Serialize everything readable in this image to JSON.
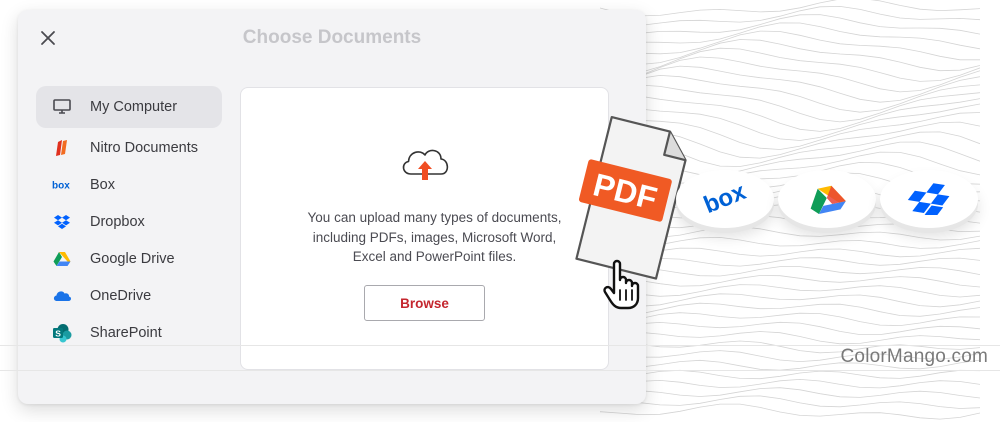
{
  "dialog": {
    "title": "Choose Documents"
  },
  "sidebar": {
    "items": [
      {
        "label": "My Computer",
        "icon": "monitor-icon",
        "active": true
      },
      {
        "label": "Nitro Documents",
        "icon": "nitro-icon"
      },
      {
        "label": "Box",
        "icon": "box-logo-icon"
      },
      {
        "label": "Dropbox",
        "icon": "dropbox-icon"
      },
      {
        "label": "Google Drive",
        "icon": "google-drive-icon"
      },
      {
        "label": "OneDrive",
        "icon": "onedrive-icon"
      },
      {
        "label": "SharePoint",
        "icon": "sharepoint-icon"
      }
    ]
  },
  "upload": {
    "line1": "You can upload many types of documents,",
    "line2": "including PDFs, images, Microsoft Word,",
    "line3": "Excel and PowerPoint files.",
    "browse_label": "Browse"
  },
  "promo": {
    "pdf_label": "PDF",
    "services": [
      "box-logo-icon",
      "google-drive-icon",
      "dropbox-icon"
    ]
  },
  "watermark": "ColorMango.com",
  "colors": {
    "accent": "#c4262e",
    "pdf_orange": "#f05a24",
    "upload_arrow": "#f04e23",
    "box_blue": "#0061d5",
    "dropbox_blue": "#0061fe"
  }
}
